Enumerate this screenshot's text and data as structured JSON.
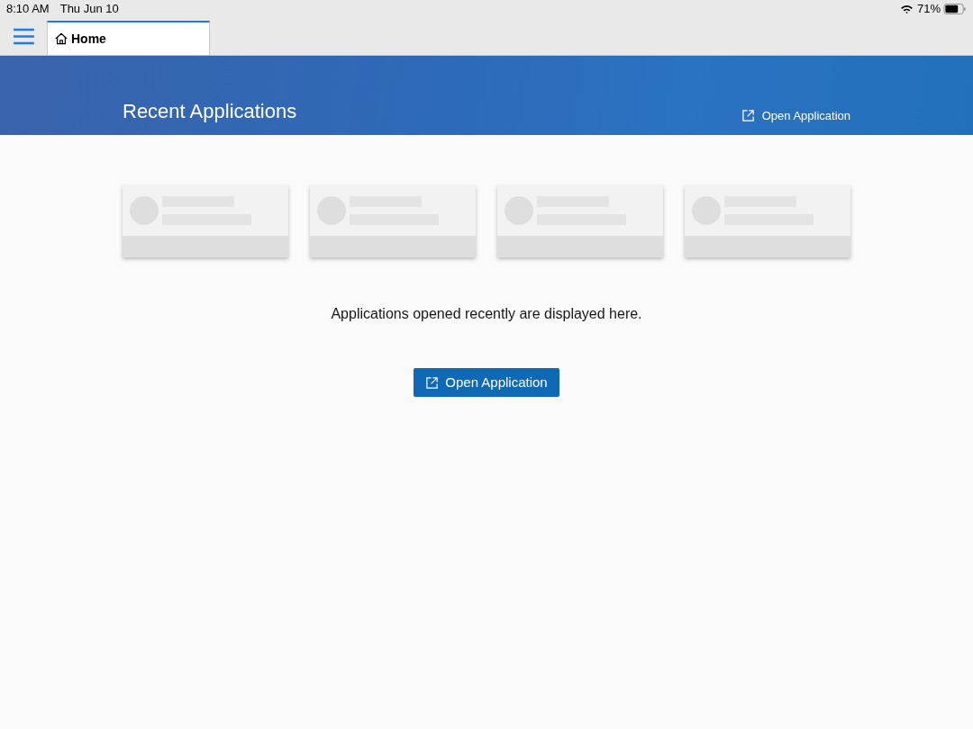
{
  "status_bar": {
    "time": "8:10 AM",
    "date": "Thu Jun 10",
    "battery": "71%"
  },
  "tabs": [
    {
      "label": "Home",
      "selected": true
    }
  ],
  "banner": {
    "title": "Recent Applications",
    "action": "Open Application"
  },
  "placeholder_cards": [
    {
      "kind": "skeleton"
    },
    {
      "kind": "skeleton"
    },
    {
      "kind": "skeleton"
    },
    {
      "kind": "skeleton"
    }
  ],
  "empty_message": "Applications opened recently are displayed here.",
  "primary_button": "Open Application"
}
